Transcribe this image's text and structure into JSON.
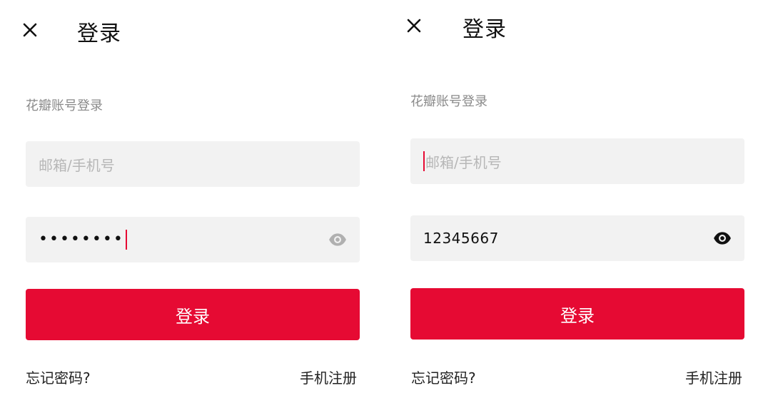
{
  "screens": [
    {
      "title": "登录",
      "subtitle": "花瓣账号登录",
      "account_field": {
        "placeholder": "邮箱/手机号",
        "value": ""
      },
      "password_field": {
        "masked_value": "••••••••",
        "visible": false
      },
      "login_button": "登录",
      "forgot_link": "忘记密码?",
      "register_link": "手机注册"
    },
    {
      "title": "登录",
      "subtitle": "花瓣账号登录",
      "account_field": {
        "placeholder": "邮箱/手机号",
        "value": ""
      },
      "password_field": {
        "value": "12345667",
        "visible": true
      },
      "login_button": "登录",
      "forgot_link": "忘记密码?",
      "register_link": "手机注册"
    }
  ],
  "colors": {
    "accent": "#e60a33",
    "field_bg": "#f2f2f2",
    "muted_text": "#8a8a8a",
    "placeholder_text": "#b7b7b7"
  },
  "icons": {
    "close": "close-icon",
    "password_toggle_off": "eye-icon-hidden",
    "password_toggle_on": "eye-icon-visible"
  }
}
